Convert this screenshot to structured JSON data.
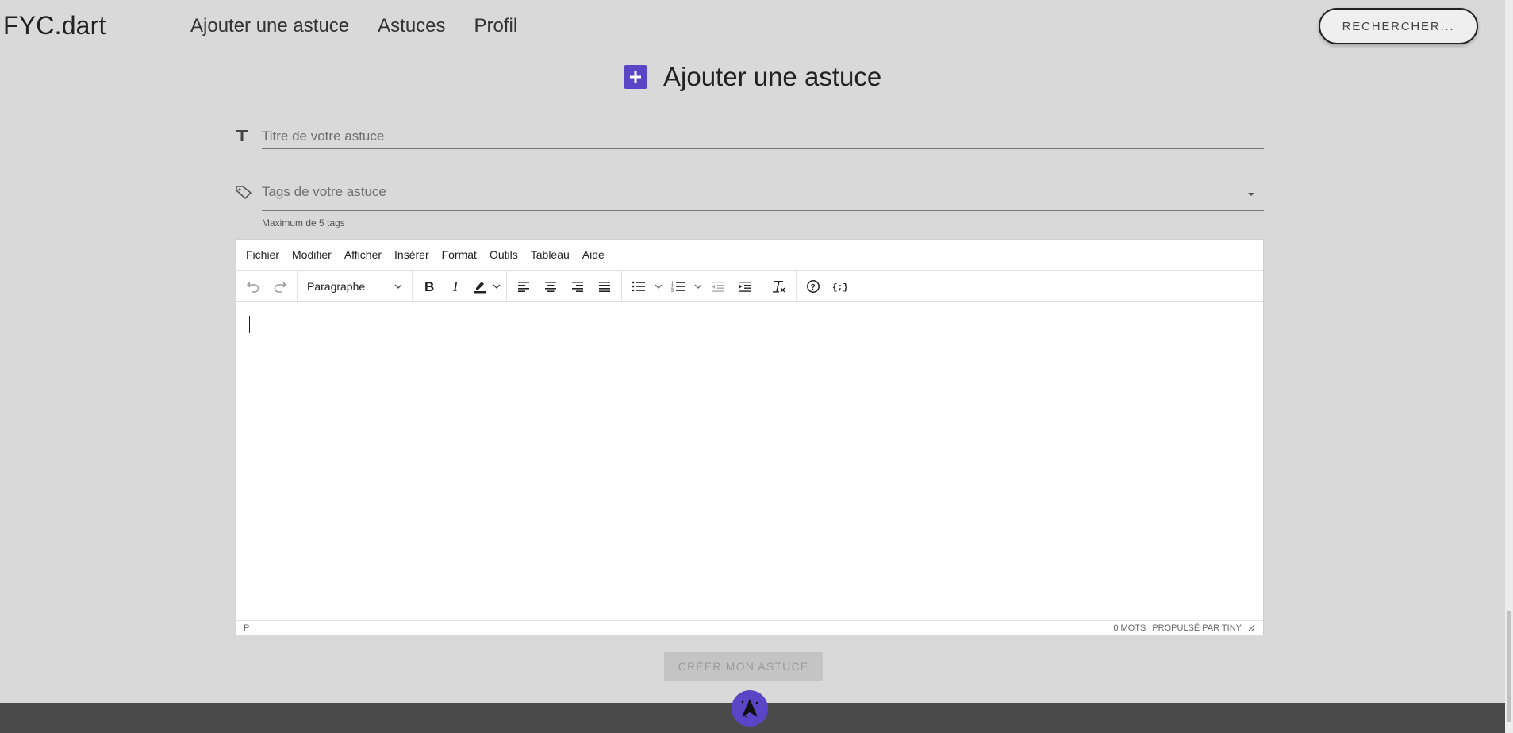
{
  "header": {
    "brand": "FYC.dart",
    "nav": [
      "Ajouter une astuce",
      "Astuces",
      "Profil"
    ],
    "search_label": "RECHERCHER..."
  },
  "page": {
    "title": "Ajouter une astuce"
  },
  "form": {
    "title_placeholder": "Titre de votre astuce",
    "tags_placeholder": "Tags de votre astuce",
    "tags_helper": "Maximum de 5 tags"
  },
  "editor": {
    "menu": [
      "Fichier",
      "Modifier",
      "Afficher",
      "Insérer",
      "Format",
      "Outils",
      "Tableau",
      "Aide"
    ],
    "block_format": "Paragraphe",
    "status_path": "P",
    "word_count": "0 MOTS",
    "powered_by": "PROPULSÉ PAR TINY"
  },
  "submit_label": "CRÉER MON ASTUCE",
  "colors": {
    "accent": "#5a45c6",
    "background": "#d9d9d9",
    "footer": "#4a4a4a"
  }
}
